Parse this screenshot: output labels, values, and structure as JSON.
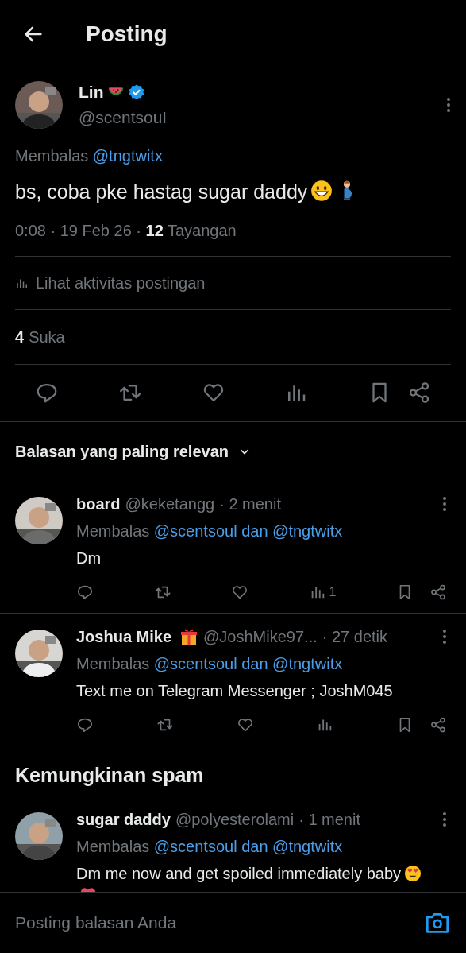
{
  "header": {
    "title": "Posting"
  },
  "post": {
    "name": "Lin",
    "name_icons": [
      {
        "kind": "watermelon"
      }
    ],
    "verified": true,
    "handle": "@scentsouI",
    "reply_prefix": "Membalas",
    "reply_to": "@tngtwitx",
    "text": "bs, coba pke hastag sugar daddy",
    "text_icons": [
      {
        "kind": "grinning"
      },
      {
        "kind": "pregnant-man"
      }
    ],
    "time": "0:08 · 19 Feb 26 · ",
    "views_count": "12",
    "views_label": "Tayangan",
    "activity": "Lihat aktivitas postingan",
    "likes_count": "4",
    "likes_label": "Suka"
  },
  "sort": {
    "label": "Balasan yang paling relevan"
  },
  "replies": [
    {
      "name": "board",
      "handle": "@keketangg",
      "time": "· 2 menit",
      "reply_prefix": "Membalas",
      "reply_to": "@scentsoul dan @tngtwitx",
      "text": "Dm",
      "views": "1"
    },
    {
      "name": "Joshua Mike",
      "name_icons": [
        {
          "kind": "gift"
        }
      ],
      "handle": "@JoshMike97...",
      "time": "· 27 detik",
      "reply_prefix": "Membalas",
      "reply_to": "@scentsoul dan @tngtwitx",
      "text": "Text me on Telegram Messenger ; JoshM045"
    }
  ],
  "spam_section": {
    "title": "Kemungkinan spam",
    "replies": [
      {
        "name": "sugar daddy",
        "handle": "@polyesterolami",
        "time": "· 1 menit",
        "reply_prefix": "Membalas",
        "reply_to": "@scentsoul dan @tngtwitx",
        "text": "Dm me now and get spoiled immediately baby",
        "text_icons": [
          {
            "kind": "heart-eyes"
          },
          {
            "kind": "red-heart"
          }
        ]
      }
    ]
  },
  "composer": {
    "placeholder": "Posting balasan Anda"
  }
}
